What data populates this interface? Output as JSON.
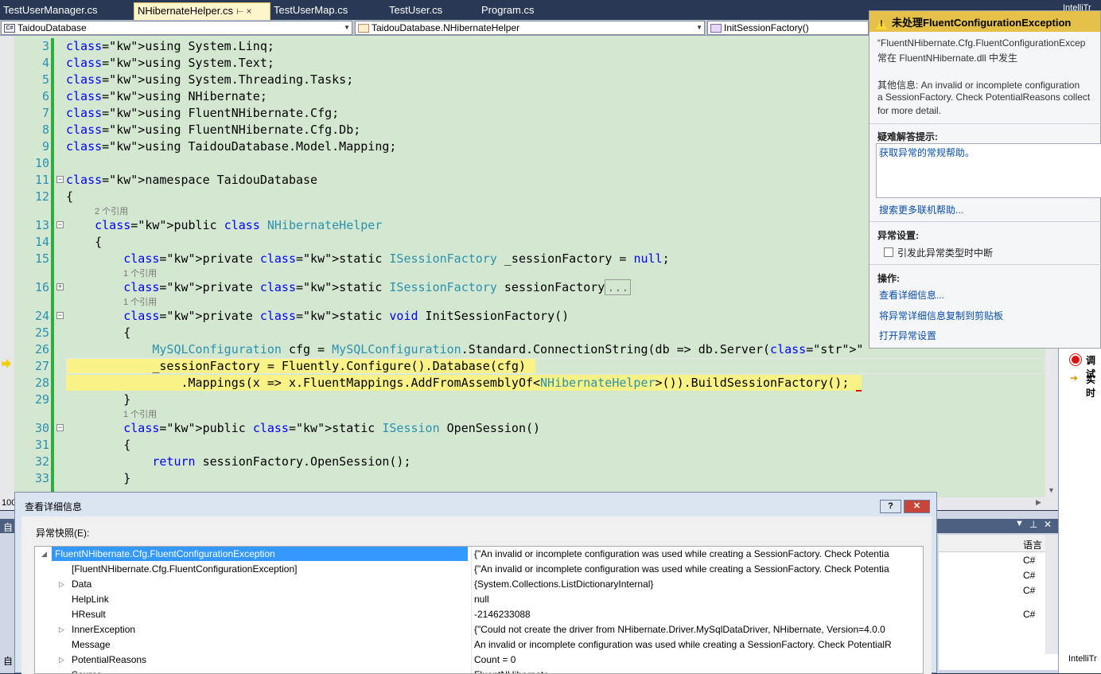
{
  "tabs": [
    {
      "label": "TestUserManager.cs",
      "active": false
    },
    {
      "label": "NHibernateHelper.cs",
      "active": true
    },
    {
      "label": "TestUserMap.cs",
      "active": false
    },
    {
      "label": "TestUser.cs",
      "active": false
    },
    {
      "label": "Program.cs",
      "active": false
    }
  ],
  "tab_pin": "⊢",
  "tab_close": "×",
  "intellitrace_tab": "IntelliTr",
  "navbar": {
    "project": "TaidouDatabase",
    "class": "TaidouDatabase.NHibernateHelper",
    "member": "InitSessionFactory()"
  },
  "code": {
    "lines": [
      {
        "n": "3",
        "text": "using System.Linq;"
      },
      {
        "n": "4",
        "text": "using System.Text;"
      },
      {
        "n": "5",
        "text": "using System.Threading.Tasks;"
      },
      {
        "n": "6",
        "text": "using NHibernate;"
      },
      {
        "n": "7",
        "text": "using FluentNHibernate.Cfg;"
      },
      {
        "n": "8",
        "text": "using FluentNHibernate.Cfg.Db;"
      },
      {
        "n": "9",
        "text": "using TaidouDatabase.Model.Mapping;"
      },
      {
        "n": "10",
        "text": ""
      },
      {
        "n": "11",
        "text": "namespace TaidouDatabase"
      },
      {
        "n": "12",
        "text": "{"
      },
      {
        "n": "13",
        "text": "    public class NHibernateHelper"
      },
      {
        "n": "14",
        "text": "    {"
      },
      {
        "n": "15",
        "text": "        private static ISessionFactory _sessionFactory = null;"
      },
      {
        "n": "16",
        "text": "        private static ISessionFactory sessionFactory..."
      },
      {
        "n": "24",
        "text": "        private static void InitSessionFactory()"
      },
      {
        "n": "25",
        "text": "        {"
      },
      {
        "n": "26",
        "text": "            MySQLConfiguration cfg = MySQLConfiguration.Standard.ConnectionString(db => db.Server(\"localhost\").Database(\"test_taidou\").Us"
      },
      {
        "n": "27",
        "text": "            _sessionFactory = Fluently.Configure().Database(cfg)"
      },
      {
        "n": "28",
        "text": "                .Mappings(x => x.FluentMappings.AddFromAssemblyOf<NHibernateHelper>()).BuildSessionFactory();"
      },
      {
        "n": "29",
        "text": "        }"
      },
      {
        "n": "30",
        "text": "        public static ISession OpenSession()"
      },
      {
        "n": "31",
        "text": "        {"
      },
      {
        "n": "32",
        "text": "            return sessionFactory.OpenSession();"
      },
      {
        "n": "33",
        "text": "        }"
      }
    ],
    "refs": {
      "r2": "2 个引用",
      "r1a": "1 个引用",
      "r1b": "1 个引用",
      "r1c": "1 个引用"
    },
    "zoom": "100"
  },
  "exception_popup": {
    "title": "未处理FluentConfigurationException",
    "line1": "“FluentNHibernate.Cfg.FluentConfigurationExcep",
    "line2": "常在 FluentNHibernate.dll 中发生",
    "info1": "其他信息: An invalid or incomplete configuration",
    "info2": "a SessionFactory. Check PotentialReasons collect",
    "info3": "for more detail.",
    "troubleshoot_heading": "疑难解答提示:",
    "troubleshoot_link": "获取异常的常规帮助。",
    "search_link": "搜索更多联机帮助...",
    "settings_heading": "异常设置:",
    "break_checkbox": "引发此异常类型时中断",
    "actions_heading": "操作:",
    "action_view": "查看详细信息...",
    "action_copy": "将异常详细信息复制到剪贴板",
    "action_open": "打开异常设置"
  },
  "right_panel": {
    "item1": "调试",
    "item2": "实时"
  },
  "bottom_panel": {
    "header_left": "自",
    "lang_header": "语言",
    "lang_rows": [
      "C#",
      "C#",
      "C#",
      "C#"
    ],
    "footer_left": "自"
  },
  "dialog": {
    "title": "查看详细信息",
    "help_btn": "?",
    "close_btn": "✕",
    "snapshot_label": "异常快照(E):",
    "rows": [
      {
        "name": "FluentNHibernate.Cfg.FluentConfigurationException",
        "value": "{\"An invalid or incomplete configuration was used while creating a SessionFactory. Check Potentia",
        "expander": "◢",
        "selected": true
      },
      {
        "name": "[FluentNHibernate.Cfg.FluentConfigurationException]",
        "value": "{\"An invalid or incomplete configuration was used while creating a SessionFactory. Check Potentia",
        "expander": "",
        "selected": false
      },
      {
        "name": "Data",
        "value": "{System.Collections.ListDictionaryInternal}",
        "expander": "▷",
        "selected": false
      },
      {
        "name": "HelpLink",
        "value": "null",
        "expander": "",
        "selected": false
      },
      {
        "name": "HResult",
        "value": "-2146233088",
        "expander": "",
        "selected": false
      },
      {
        "name": "InnerException",
        "value": "{\"Could not create the driver from NHibernate.Driver.MySqlDataDriver, NHibernate, Version=4.0.0",
        "expander": "▷",
        "selected": false
      },
      {
        "name": "Message",
        "value": "An invalid or incomplete configuration was used while creating a SessionFactory. Check PotentialR",
        "expander": "",
        "selected": false
      },
      {
        "name": "PotentialReasons",
        "value": "Count = 0",
        "expander": "▷",
        "selected": false
      },
      {
        "name": "Source",
        "value": "FluentNHibernate",
        "expander": "",
        "selected": false
      }
    ]
  },
  "colors": {
    "chrome": "#293955",
    "code_bg": "#d4e8d1",
    "highlight": "#f8f287",
    "keyword": "#0000ff",
    "type": "#2b91af",
    "popup_header": "#e6c14a",
    "selection": "#3399ff"
  }
}
